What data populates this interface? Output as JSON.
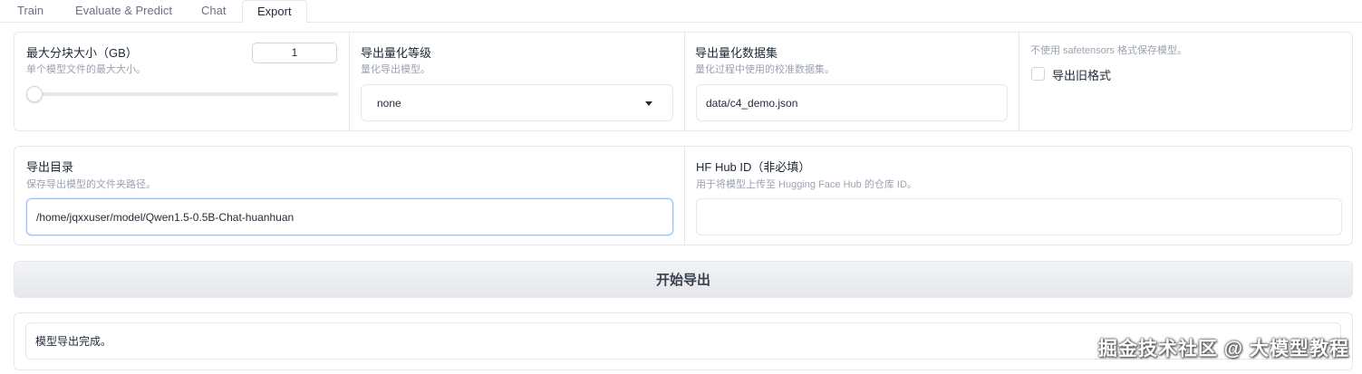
{
  "tabs": [
    {
      "label": "Train"
    },
    {
      "label": "Evaluate & Predict"
    },
    {
      "label": "Chat"
    },
    {
      "label": "Export"
    }
  ],
  "max_shard": {
    "label": "最大分块大小（GB）",
    "info": "单个模型文件的最大大小。",
    "value": "1",
    "slider_fraction": 0.0
  },
  "quant_bit": {
    "label": "导出量化等级",
    "info": "量化导出模型。",
    "value": "none"
  },
  "quant_dataset": {
    "label": "导出量化数据集",
    "info": "量化过程中使用的校准数据集。",
    "value": "data/c4_demo.json"
  },
  "legacy": {
    "info": "不使用 safetensors 格式保存模型。",
    "label": "导出旧格式"
  },
  "export_dir": {
    "label": "导出目录",
    "info": "保存导出模型的文件夹路径。",
    "value": "/home/jqxxuser/model/Qwen1.5-0.5B-Chat-huanhuan"
  },
  "hub_id": {
    "label": "HF Hub ID（非必填）",
    "info": "用于将模型上传至 Hugging Face Hub 的仓库 ID。",
    "value": ""
  },
  "export_button": {
    "label": "开始导出"
  },
  "output": {
    "value": "模型导出完成。"
  },
  "watermark": {
    "text": "掘金技术社区 @ 大模型教程"
  }
}
